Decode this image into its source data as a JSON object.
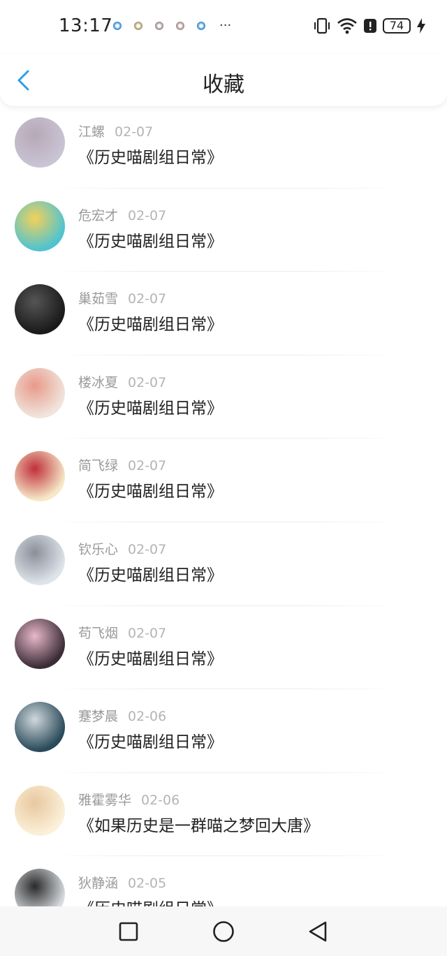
{
  "status_bar": {
    "time": "13:17",
    "notification_icons": [
      {
        "name": "app-notification-icon-1",
        "color": "#3b8fd4"
      },
      {
        "name": "app-notification-icon-2",
        "color": "#a89c6a"
      },
      {
        "name": "app-notification-icon-3",
        "color": "#a08a9a"
      },
      {
        "name": "app-notification-icon-4",
        "color": "#a3908c"
      },
      {
        "name": "app-notification-icon-5",
        "color": "#3a8ed0"
      }
    ],
    "more_label": "···",
    "battery_level": "74",
    "icons": [
      "vibrate-icon",
      "wifi-icon",
      "alert-icon",
      "battery-icon",
      "charging-icon"
    ]
  },
  "header": {
    "title": "收藏",
    "back_icon": "chevron-left-icon",
    "accent_color": "#2e9ee8"
  },
  "favorites": [
    {
      "user": "江螺",
      "date": "02-07",
      "book": "《历史喵剧组日常》",
      "avatar_colors": [
        "#c9c3d4",
        "#b7a9b7"
      ]
    },
    {
      "user": "危宏才",
      "date": "02-07",
      "book": "《历史喵剧组日常》",
      "avatar_colors": [
        "#4fc3d0",
        "#f3d15a"
      ]
    },
    {
      "user": "巢茹雪",
      "date": "02-07",
      "book": "《历史喵剧组日常》",
      "avatar_colors": [
        "#1a1a1a",
        "#555555"
      ]
    },
    {
      "user": "楼冰夏",
      "date": "02-07",
      "book": "《历史喵剧组日常》",
      "avatar_colors": [
        "#f0e4dc",
        "#e89a8a"
      ]
    },
    {
      "user": "简飞绿",
      "date": "02-07",
      "book": "《历史喵剧组日常》",
      "avatar_colors": [
        "#f6e8c8",
        "#c0303a"
      ]
    },
    {
      "user": "钦乐心",
      "date": "02-07",
      "book": "《历史喵剧组日常》",
      "avatar_colors": [
        "#dfe4ea",
        "#8a8f9a"
      ]
    },
    {
      "user": "苟飞烟",
      "date": "02-07",
      "book": "《历史喵剧组日常》",
      "avatar_colors": [
        "#3a2c36",
        "#e8b8c8"
      ]
    },
    {
      "user": "蹇梦晨",
      "date": "02-06",
      "book": "《历史喵剧组日常》",
      "avatar_colors": [
        "#2a4a5a",
        "#d0d8dc"
      ]
    },
    {
      "user": "雅霍雾华",
      "date": "02-06",
      "book": "《如果历史是一群喵之梦回大唐》",
      "avatar_colors": [
        "#fbf0d8",
        "#e8c8a0"
      ]
    },
    {
      "user": "狄静涵",
      "date": "02-05",
      "book": "《历史喵剧组日常》",
      "avatar_colors": [
        "#d8dce0",
        "#2a2a2a"
      ]
    }
  ],
  "nav_bar": {
    "buttons": [
      "recent-apps-square-icon",
      "home-circle-icon",
      "back-triangle-icon"
    ]
  }
}
